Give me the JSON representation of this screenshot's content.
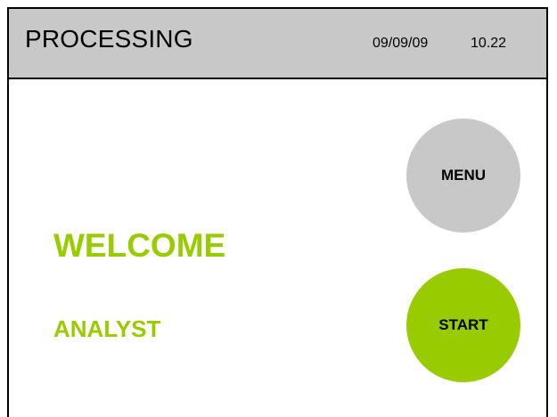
{
  "header": {
    "title": "PROCESSING",
    "date": "09/09/09",
    "time": "10.22"
  },
  "main": {
    "welcome_text": "WELCOME",
    "user_name": "ANALYST"
  },
  "buttons": {
    "menu_label": "MENU",
    "start_label": "START"
  },
  "colors": {
    "accent": "#99cc00",
    "header_bg": "#c8c8c8",
    "menu_button_bg": "#c8c8c8",
    "start_button_bg": "#99cc00",
    "border": "#000000"
  }
}
